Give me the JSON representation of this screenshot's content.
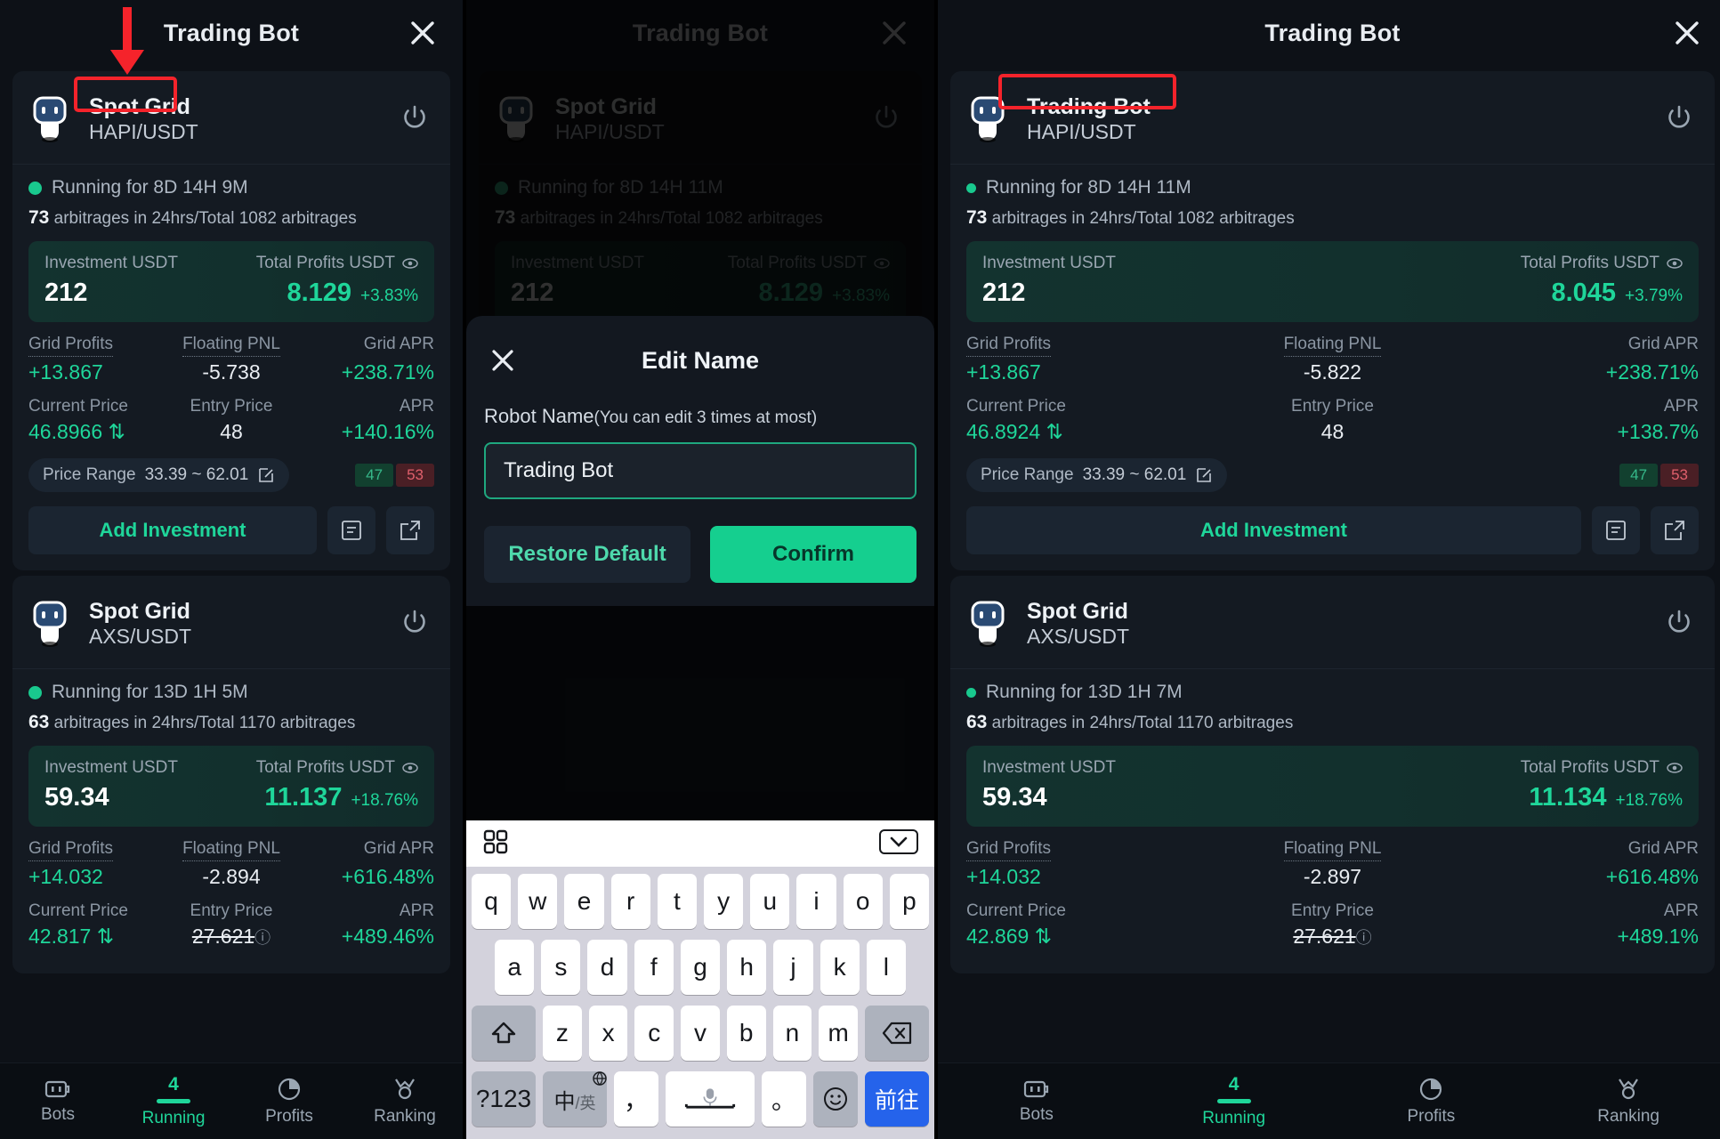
{
  "panels": {
    "left": {
      "titlebar": {
        "title": "Trading Bot",
        "close_icon": "close-icon"
      },
      "cards": [
        {
          "name": "Spot Grid",
          "pair": "HAPI/USDT",
          "status": "Running for 8D 14H 9M",
          "arb_count": "73",
          "arb_text": "arbitrages in 24hrs/Total 1082 arbitrages",
          "investment_label": "Investment USDT",
          "investment_value": "212",
          "profits_label": "Total Profits USDT",
          "profits_value": "8.129",
          "profits_pct": "+3.83%",
          "grid_profits_label": "Grid Profits",
          "grid_profits_value": "+13.867",
          "floating_pnl_label": "Floating PNL",
          "floating_pnl_value": "-5.738",
          "grid_apr_label": "Grid APR",
          "grid_apr_value": "+238.71%",
          "current_price_label": "Current Price",
          "current_price_value": "46.8966",
          "entry_price_label": "Entry Price",
          "entry_price_value": "48",
          "apr_label": "APR",
          "apr_value": "+140.16%",
          "range_label": "Price Range",
          "range_value": "33.39 ~ 62.01",
          "buy_count": "47",
          "sell_count": "53",
          "add_investment": "Add Investment"
        },
        {
          "name": "Spot Grid",
          "pair": "AXS/USDT",
          "status": "Running for 13D 1H 5M",
          "arb_count": "63",
          "arb_text": "arbitrages in 24hrs/Total 1170 arbitrages",
          "investment_label": "Investment USDT",
          "investment_value": "59.34",
          "profits_label": "Total Profits USDT",
          "profits_value": "11.137",
          "profits_pct": "+18.76%",
          "grid_profits_label": "Grid Profits",
          "grid_profits_value": "+14.032",
          "floating_pnl_label": "Floating PNL",
          "floating_pnl_value": "-2.894",
          "grid_apr_label": "Grid APR",
          "grid_apr_value": "+616.48%",
          "current_price_label": "Current Price",
          "current_price_value": "42.817",
          "entry_price_label": "Entry Price",
          "entry_price_value": "27.621",
          "apr_label": "APR",
          "apr_value": "+489.46%"
        }
      ],
      "highlight_label": "Spot Grid"
    },
    "mid": {
      "titlebar": {
        "title": "Trading Bot",
        "close_icon": "close-icon"
      },
      "card": {
        "name": "Spot Grid",
        "pair": "HAPI/USDT",
        "status": "Running for 8D 14H 11M",
        "arb_count": "73",
        "arb_text": "arbitrages in 24hrs/Total 1082 arbitrages",
        "investment_label": "Investment USDT",
        "investment_value": "212",
        "profits_label": "Total Profits USDT",
        "profits_value": "8.129",
        "profits_pct": "+3.83%",
        "grid_profits_label": "Grid Profits",
        "floating_pnl_label": "Floating PNL",
        "grid_apr_label": "Grid APR"
      },
      "modal": {
        "title": "Edit Name",
        "close_icon": "close-icon",
        "field_label": "Robot Name",
        "field_hint": "(You can edit 3 times at most)",
        "input_value": "Trading Bot",
        "input_placeholder": "Robot Name",
        "restore_label": "Restore Default",
        "confirm_label": "Confirm"
      },
      "keyboard": {
        "grid_icon": "keyboard-grid-icon",
        "collapse_icon": "chevron-down-icon",
        "row1": [
          "q",
          "w",
          "e",
          "r",
          "t",
          "y",
          "u",
          "i",
          "o",
          "p"
        ],
        "row2": [
          "a",
          "s",
          "d",
          "f",
          "g",
          "h",
          "j",
          "k",
          "l"
        ],
        "row3_shift": "⇧",
        "row3": [
          "z",
          "x",
          "c",
          "v",
          "b",
          "n",
          "m"
        ],
        "row3_backspace": "⌫",
        "numeric_key": "?123",
        "lang_key": "中/英",
        "comma_key": "，",
        "space_key": "space",
        "period_key": "。",
        "emoji_key": "☺",
        "go_key": "前往"
      }
    },
    "right": {
      "titlebar": {
        "title": "Trading Bot",
        "close_icon": "close-icon"
      },
      "cards": [
        {
          "name": "Trading Bot",
          "pair": "HAPI/USDT",
          "status": "Running for 8D 14H 11M",
          "arb_count": "73",
          "arb_text": "arbitrages in 24hrs/Total 1082 arbitrages",
          "investment_label": "Investment USDT",
          "investment_value": "212",
          "profits_label": "Total Profits USDT",
          "profits_value": "8.045",
          "profits_pct": "+3.79%",
          "grid_profits_label": "Grid Profits",
          "grid_profits_value": "+13.867",
          "floating_pnl_label": "Floating PNL",
          "floating_pnl_value": "-5.822",
          "grid_apr_label": "Grid APR",
          "grid_apr_value": "+238.71%",
          "current_price_label": "Current Price",
          "current_price_value": "46.8924",
          "entry_price_label": "Entry Price",
          "entry_price_value": "48",
          "apr_label": "APR",
          "apr_value": "+138.7%",
          "range_label": "Price Range",
          "range_value": "33.39 ~ 62.01",
          "buy_count": "47",
          "sell_count": "53",
          "add_investment": "Add Investment"
        },
        {
          "name": "Spot Grid",
          "pair": "AXS/USDT",
          "status": "Running for 13D 1H 7M",
          "arb_count": "63",
          "arb_text": "arbitrages in 24hrs/Total 1170 arbitrages",
          "investment_label": "Investment USDT",
          "investment_value": "59.34",
          "profits_label": "Total Profits USDT",
          "profits_value": "11.134",
          "profits_pct": "+18.76%",
          "grid_profits_label": "Grid Profits",
          "grid_profits_value": "+14.032",
          "floating_pnl_label": "Floating PNL",
          "floating_pnl_value": "-2.897",
          "grid_apr_label": "Grid APR",
          "grid_apr_value": "+616.48%",
          "current_price_label": "Current Price",
          "current_price_value": "42.869",
          "entry_price_label": "Entry Price",
          "entry_price_value": "27.621",
          "apr_label": "APR",
          "apr_value": "+489.1%"
        }
      ],
      "highlight_label": "Trading Bot"
    }
  },
  "bottom_nav": {
    "items": [
      {
        "label": "Bots",
        "icon": "bots-icon",
        "badge": ""
      },
      {
        "label": "Running",
        "icon": "running-icon",
        "badge": "4"
      },
      {
        "label": "Profits",
        "icon": "pie-chart-icon",
        "badge": ""
      },
      {
        "label": "Ranking",
        "icon": "ranking-icon",
        "badge": ""
      }
    ]
  },
  "colors": {
    "accent_green": "#1fd69a",
    "annotation_red": "#f5232b",
    "sell_red": "#e0606c",
    "keyboard_blue": "#2563eb"
  }
}
